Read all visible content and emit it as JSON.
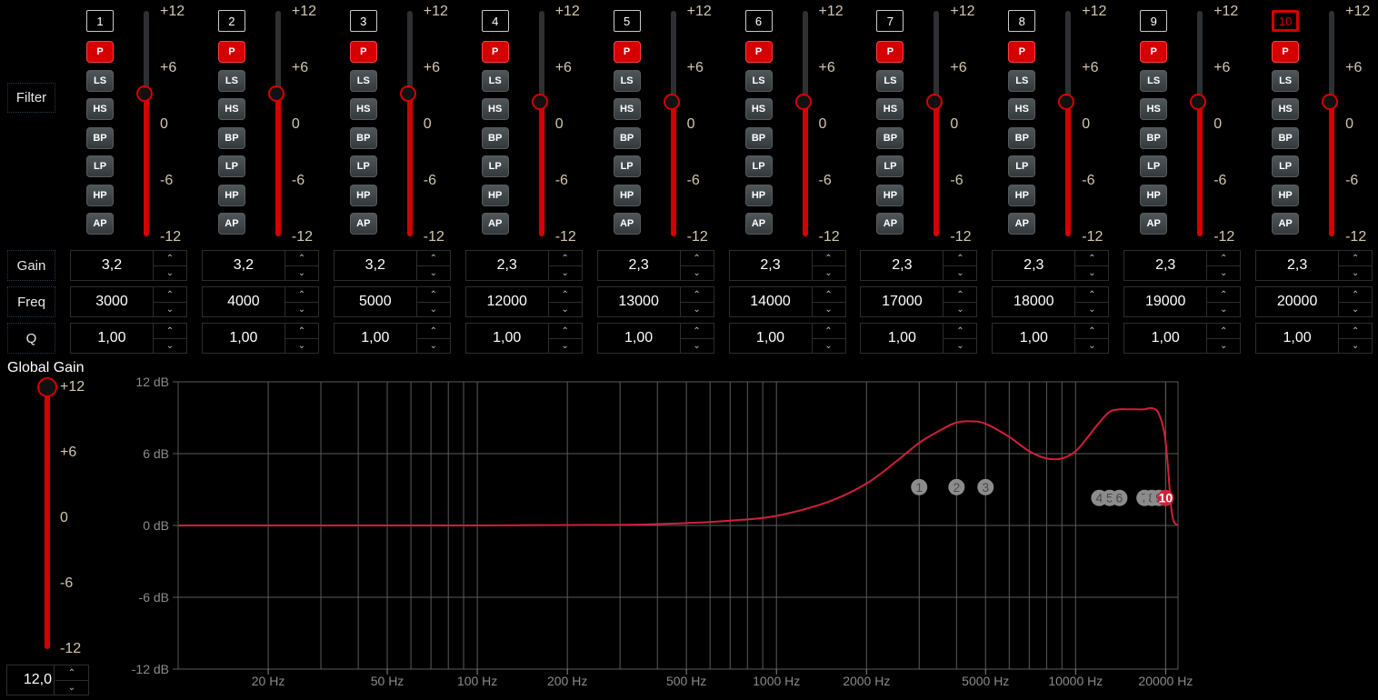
{
  "row_labels": {
    "filter": "Filter",
    "gain": "Gain",
    "freq": "Freq",
    "q": "Q"
  },
  "filter_types": [
    "P",
    "LS",
    "HS",
    "BP",
    "LP",
    "HP",
    "AP"
  ],
  "active_filter_type": "P",
  "slider_ticks": [
    "+12",
    "+6",
    "0",
    "-6",
    "-12"
  ],
  "bands": [
    {
      "number": "1",
      "selected": false,
      "gain": "3,2",
      "freq": "3000",
      "q": "1,00",
      "gain_db": 3.2
    },
    {
      "number": "2",
      "selected": false,
      "gain": "3,2",
      "freq": "4000",
      "q": "1,00",
      "gain_db": 3.2
    },
    {
      "number": "3",
      "selected": false,
      "gain": "3,2",
      "freq": "5000",
      "q": "1,00",
      "gain_db": 3.2
    },
    {
      "number": "4",
      "selected": false,
      "gain": "2,3",
      "freq": "12000",
      "q": "1,00",
      "gain_db": 2.3
    },
    {
      "number": "5",
      "selected": false,
      "gain": "2,3",
      "freq": "13000",
      "q": "1,00",
      "gain_db": 2.3
    },
    {
      "number": "6",
      "selected": false,
      "gain": "2,3",
      "freq": "14000",
      "q": "1,00",
      "gain_db": 2.3
    },
    {
      "number": "7",
      "selected": false,
      "gain": "2,3",
      "freq": "17000",
      "q": "1,00",
      "gain_db": 2.3
    },
    {
      "number": "8",
      "selected": false,
      "gain": "2,3",
      "freq": "18000",
      "q": "1,00",
      "gain_db": 2.3
    },
    {
      "number": "9",
      "selected": false,
      "gain": "2,3",
      "freq": "19000",
      "q": "1,00",
      "gain_db": 2.3
    },
    {
      "number": "10",
      "selected": true,
      "gain": "2,3",
      "freq": "20000",
      "q": "1,00",
      "gain_db": 2.3
    }
  ],
  "global_gain": {
    "label": "Global Gain",
    "value_text": "12,0",
    "value_db": 12,
    "ticks": [
      "+12",
      "+6",
      "0",
      "-6",
      "-12"
    ]
  },
  "colors": {
    "accent": "#d40000",
    "curve": "#d0203a",
    "marker": "#8c8c8c",
    "grid": "#5a5a5a"
  },
  "chart_data": {
    "type": "line",
    "title": "",
    "xlabel": "",
    "ylabel": "",
    "x_scale": "log",
    "xlim": [
      10,
      22000
    ],
    "ylim": [
      -12,
      12
    ],
    "grid": true,
    "y_ticks": [
      "12 dB",
      "6 dB",
      "0 dB",
      "-6 dB",
      "-12 dB"
    ],
    "y_tick_values": [
      12,
      6,
      0,
      -6,
      -12
    ],
    "x_ticks": [
      "20 Hz",
      "50 Hz",
      "100 Hz",
      "200 Hz",
      "500 Hz",
      "1000 Hz",
      "2000 Hz",
      "5000 Hz",
      "10000 Hz",
      "20000 Hz"
    ],
    "x_tick_values": [
      20,
      50,
      100,
      200,
      500,
      1000,
      2000,
      5000,
      10000,
      20000
    ],
    "series": [
      {
        "x": [
          10,
          100,
          300,
          500,
          700,
          1000,
          1500,
          2000,
          2500,
          3000,
          3500,
          4000,
          4500,
          5000,
          6000,
          7000,
          8000,
          9000,
          10000,
          11000,
          12000,
          13000,
          14000,
          15000,
          16000,
          17000,
          18000,
          19000,
          20000,
          21000,
          22000
        ],
        "y": [
          0,
          0,
          0.05,
          0.2,
          0.4,
          0.8,
          2.0,
          3.5,
          5.3,
          6.9,
          7.9,
          8.6,
          8.7,
          8.5,
          7.4,
          6.2,
          5.6,
          5.6,
          6.2,
          7.4,
          8.6,
          9.5,
          9.7,
          9.7,
          9.7,
          9.7,
          9.8,
          9.3,
          7.0,
          1.0,
          0
        ]
      }
    ],
    "markers": [
      {
        "label": "1",
        "freq": 3000,
        "db": 3.2,
        "active": false
      },
      {
        "label": "2",
        "freq": 4000,
        "db": 3.2,
        "active": false
      },
      {
        "label": "3",
        "freq": 5000,
        "db": 3.2,
        "active": false
      },
      {
        "label": "4",
        "freq": 12000,
        "db": 2.3,
        "active": false
      },
      {
        "label": "5",
        "freq": 13000,
        "db": 2.3,
        "active": false
      },
      {
        "label": "6",
        "freq": 14000,
        "db": 2.3,
        "active": false
      },
      {
        "label": "7",
        "freq": 17000,
        "db": 2.3,
        "active": false
      },
      {
        "label": "8",
        "freq": 18000,
        "db": 2.3,
        "active": false
      },
      {
        "label": "9",
        "freq": 19000,
        "db": 2.3,
        "active": false
      },
      {
        "label": "10",
        "freq": 20000,
        "db": 2.3,
        "active": true
      }
    ]
  }
}
